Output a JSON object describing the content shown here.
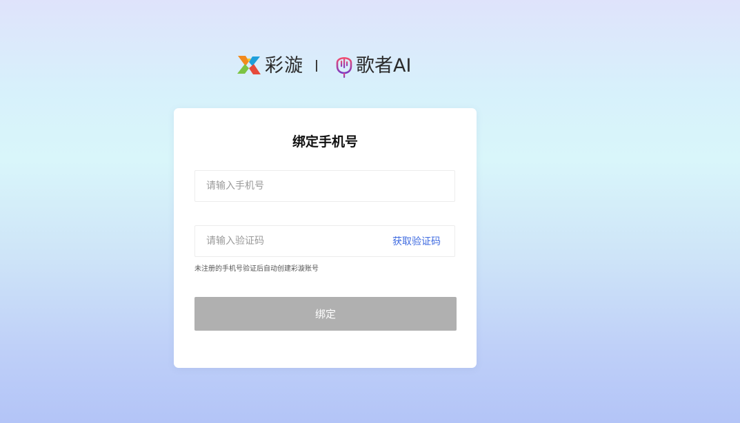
{
  "brand": {
    "name": "彩漩",
    "partner_name": "歌者AI",
    "logo_icon": "caixuan-x-logo-icon",
    "partner_icon": "singer-mic-icon"
  },
  "card": {
    "title": "绑定手机号",
    "phone": {
      "value": "",
      "placeholder": "请输入手机号"
    },
    "code": {
      "value": "",
      "placeholder": "请输入验证码",
      "get_code_label": "获取验证码"
    },
    "hint": "未注册的手机号验证后自动创建彩漩账号",
    "submit_label": "绑定"
  },
  "colors": {
    "link": "#3f6be0",
    "button_disabled": "#b0b0b0",
    "logo_orange": "#f28a1e",
    "logo_green": "#7cc443",
    "logo_blue": "#1f9fdb",
    "logo_red": "#e64a3b",
    "partner_pink": "#e2417a",
    "partner_purple": "#7d3ac2"
  }
}
